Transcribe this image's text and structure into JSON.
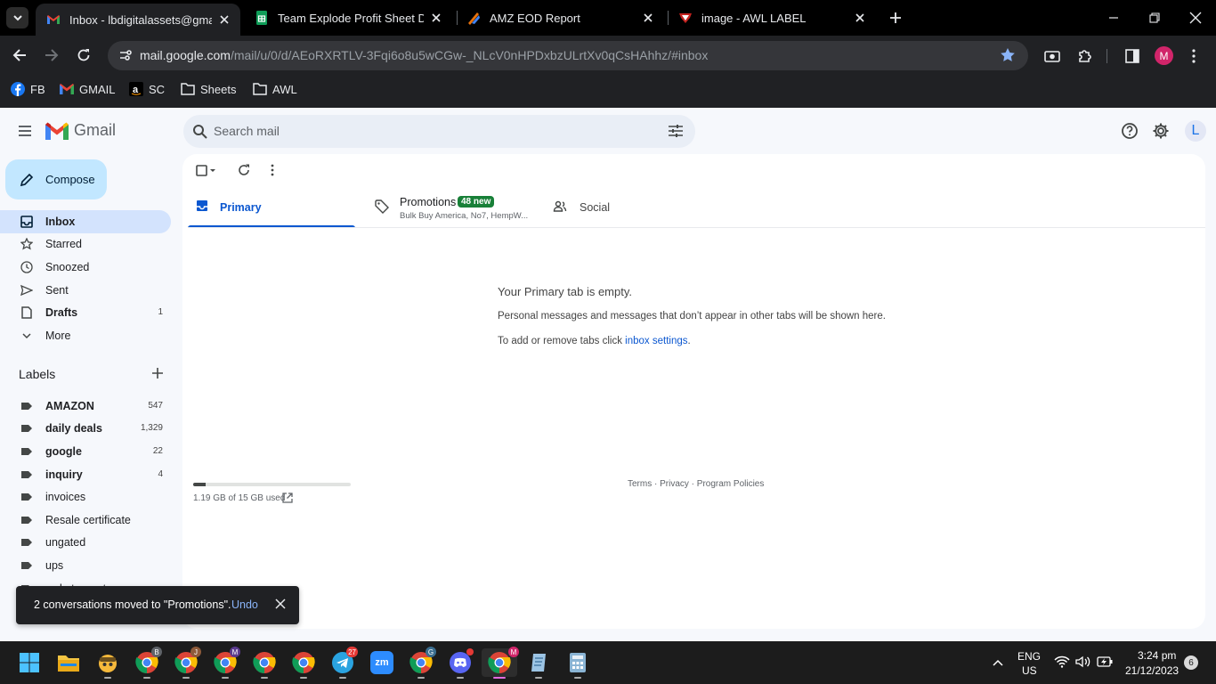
{
  "browser": {
    "tabs": [
      {
        "title": "Inbox - lbdigitalassets@gmail.com",
        "icon": "gmail-icon",
        "active": true
      },
      {
        "title": "Team Explode Profit Sheet Dec",
        "icon": "sheets-icon",
        "active": false
      },
      {
        "title": "AMZ EOD Report",
        "icon": "amz-eod-icon",
        "active": false
      },
      {
        "title": "image - AWL LABEL",
        "icon": "awl-label-icon",
        "active": false
      }
    ],
    "url_host": "mail.google.com",
    "url_path": "/mail/u/0/d/AEoRXRTLV-3Fqi6o8u5wCGw-_NLcV0nHPDxbzULrtXv0qCsHAhhz/#inbox",
    "profile_initial": "M",
    "bookmarks": [
      "FB",
      "GMAIL",
      "SC",
      "Sheets",
      "AWL"
    ]
  },
  "gmail": {
    "app_name": "Gmail",
    "search_placeholder": "Search mail",
    "account_initial": "L",
    "compose_label": "Compose",
    "nav": [
      {
        "label": "Inbox",
        "count": ""
      },
      {
        "label": "Starred",
        "count": ""
      },
      {
        "label": "Snoozed",
        "count": ""
      },
      {
        "label": "Sent",
        "count": ""
      },
      {
        "label": "Drafts",
        "count": "1"
      },
      {
        "label": "More",
        "count": ""
      }
    ],
    "labels_title": "Labels",
    "labels": [
      {
        "name": "AMAZON",
        "count": "547"
      },
      {
        "name": "daily deals",
        "count": "1,329"
      },
      {
        "name": "google",
        "count": "22"
      },
      {
        "name": "inquiry",
        "count": "4"
      },
      {
        "name": "invoices",
        "count": ""
      },
      {
        "name": "Resale certificate",
        "count": ""
      },
      {
        "name": "ungated",
        "count": ""
      },
      {
        "name": "ups",
        "count": ""
      },
      {
        "name": "webstaurant",
        "count": ""
      }
    ],
    "category_tabs": {
      "primary": "Primary",
      "promotions": "Promotions",
      "promotions_badge": "48 new",
      "promotions_snippet": "Bulk Buy America, No7, HempW...",
      "social": "Social"
    },
    "empty": {
      "title": "Your Primary tab is empty.",
      "subtitle": "Personal messages and messages that don’t appear in other tabs will be shown here.",
      "settings_prefix": "To add or remove tabs click ",
      "settings_link": "inbox settings",
      "settings_suffix": "."
    },
    "storage": {
      "text": "1.19 GB of 15 GB used",
      "fraction": 0.079
    },
    "footer": "Terms · Privacy · Program Policies",
    "toast": {
      "message": "2 conversations moved to \"Promotions\".",
      "action": "Undo"
    },
    "colors": {
      "accent": "#0b57d0",
      "compose": "#c2e7ff",
      "badge": "#188038"
    }
  },
  "taskbar": {
    "badges": {
      "chrome_b": "B",
      "chrome_j": "J",
      "chrome_m": "M",
      "telegram": "27",
      "chrome_g": "G",
      "chrome_active": "M"
    },
    "zoom_label": "zm",
    "lang": "ENG",
    "region": "US",
    "time": "3:24 pm",
    "date": "21/12/2023",
    "notifications": "6"
  }
}
